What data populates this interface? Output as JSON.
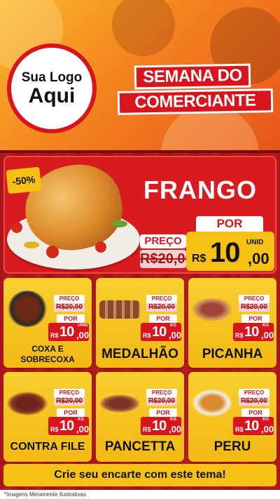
{
  "header": {
    "logo_line1": "Sua Logo",
    "logo_line2": "Aqui",
    "title_line1": "SEMANA DO",
    "title_line2": "COMERCIANTE"
  },
  "featured": {
    "discount": "-50%",
    "name": "FRANGO",
    "preco_label": "PREÇO",
    "old_price": "R$20,00",
    "por_label": "POR",
    "currency": "R$",
    "price_int": "10",
    "price_dec": ",00",
    "unit": "UNID",
    "image_icon": "roast-chicken-image"
  },
  "products": [
    {
      "name": "COXA E SOBRECOXA",
      "preco_label": "PREÇO",
      "old": "R$20,00",
      "por": "POR",
      "cur": "R$",
      "int": "10",
      "dec": ",00",
      "unit": "UNID",
      "icon": "chicken-thigh-pan-image"
    },
    {
      "name": "MEDALHÃO",
      "preco_label": "PREÇO",
      "old": "R$20,00",
      "por": "POR",
      "cur": "R$",
      "int": "10",
      "dec": ",00",
      "unit": "KG",
      "icon": "medallion-skewers-image"
    },
    {
      "name": "PICANHA",
      "preco_label": "PREÇO",
      "old": "R$20,00",
      "por": "POR",
      "cur": "R$",
      "int": "10",
      "dec": ",00",
      "unit": "KG",
      "icon": "picanha-board-image"
    },
    {
      "name": "CONTRA FILE",
      "preco_label": "PREÇO",
      "old": "R$20,00",
      "por": "POR",
      "cur": "R$",
      "int": "10",
      "dec": ",00",
      "unit": "KG",
      "icon": "contra-file-steak-image"
    },
    {
      "name": "PANCETTA",
      "preco_label": "PREÇO",
      "old": "R$20,00",
      "por": "POR",
      "cur": "R$",
      "int": "10",
      "dec": ",00",
      "unit": "KG",
      "icon": "pancetta-image"
    },
    {
      "name": "PERU",
      "preco_label": "PREÇO",
      "old": "R$20,00",
      "por": "POR",
      "cur": "R$",
      "int": "10",
      "dec": ",00",
      "unit": "KG",
      "icon": "roast-turkey-image"
    }
  ],
  "cta": "Crie seu encarte com este tema!",
  "footnote": "*Imagens Meramente Ilustrativas",
  "colors": {
    "red": "#d8141c",
    "yellow": "#f7c114",
    "orange": "#f4831f"
  }
}
